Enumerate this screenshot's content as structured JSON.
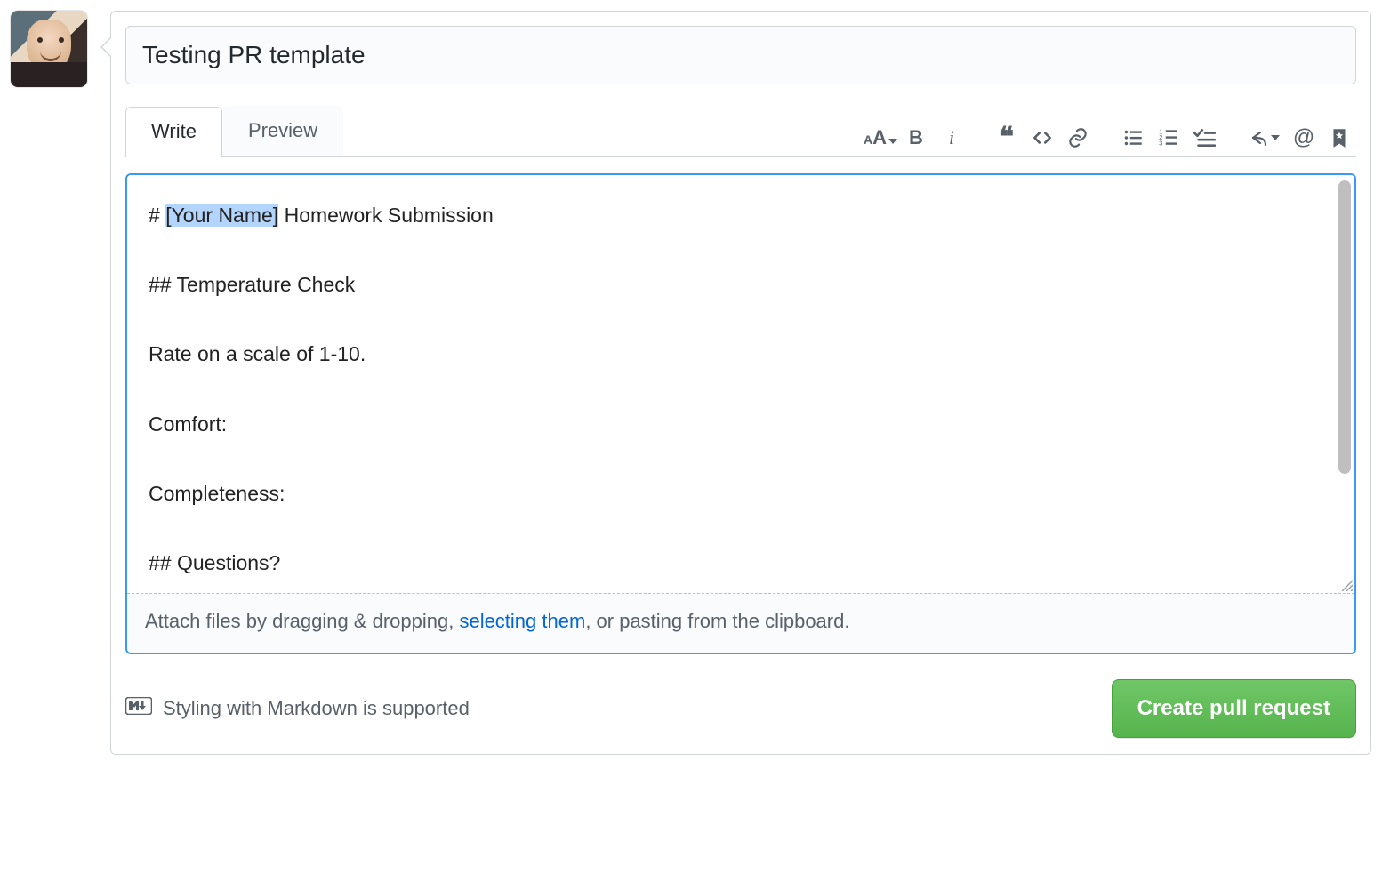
{
  "title_input": {
    "value": "Testing PR template"
  },
  "tabs": {
    "write": "Write",
    "preview": "Preview",
    "active": "write"
  },
  "toolbar": {
    "text_size": {
      "small": "A",
      "big": "A"
    },
    "bold": "B",
    "italic": "i",
    "mention": "@"
  },
  "editor": {
    "pre_selection": "# ",
    "selection": "[Your Name]",
    "post_selection": " Homework Submission\n\n## Temperature Check\n\nRate on a scale of 1-10.\n\nComfort:\n\nCompleteness:\n\n## Questions?"
  },
  "drop_hint": {
    "before": "Attach files by dragging & dropping, ",
    "link": "selecting them",
    "after": ", or pasting from the clipboard."
  },
  "markdown_hint": "Styling with Markdown is supported",
  "submit_label": "Create pull request"
}
